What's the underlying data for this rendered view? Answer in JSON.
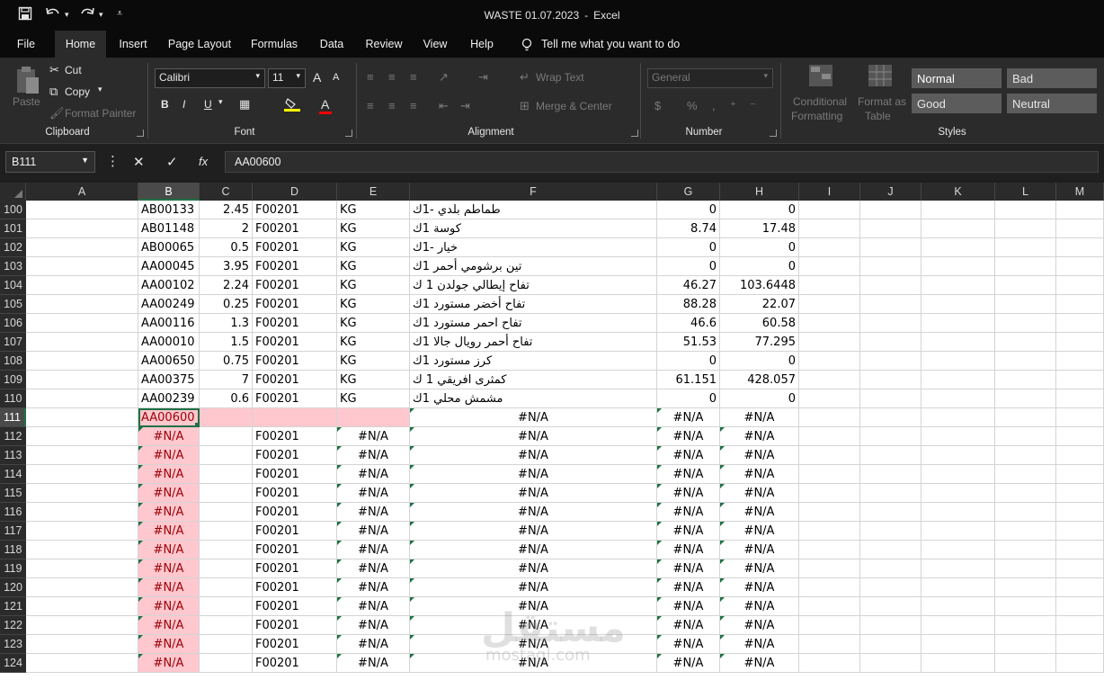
{
  "window": {
    "file_name": "WASTE 01.07.2023",
    "separator": "-",
    "app_name": "Excel"
  },
  "quick_access": {
    "save_icon": "save-icon",
    "undo_icon": "undo-icon",
    "redo_icon": "redo-icon",
    "customize_icon": "customize-icon"
  },
  "tabs": [
    "File",
    "Home",
    "Insert",
    "Page Layout",
    "Formulas",
    "Data",
    "Review",
    "View",
    "Help"
  ],
  "tell_me": "Tell me what you want to do",
  "ribbon": {
    "clipboard": {
      "paste": "Paste",
      "cut": "Cut",
      "copy": "Copy",
      "format_painter": "Format Painter",
      "label": "Clipboard"
    },
    "font": {
      "font_name": "Calibri",
      "font_size": "11",
      "bold": "B",
      "italic": "I",
      "underline": "U",
      "grow": "A",
      "shrink": "A",
      "font_color": "A",
      "label": "Font"
    },
    "alignment": {
      "wrap_text": "Wrap Text",
      "merge_center": "Merge & Center",
      "label": "Alignment"
    },
    "number": {
      "format": "General",
      "currency": "$",
      "percent": "%",
      "label": "Number"
    },
    "styles": {
      "conditional_formatting_1": "Conditional",
      "conditional_formatting_2": "Formatting",
      "format_as_table_1": "Format as",
      "format_as_table_2": "Table",
      "normal": "Normal",
      "bad": "Bad",
      "good": "Good",
      "neutral": "Neutral",
      "label": "Styles",
      "colors": {
        "normal_bg": "#5a5a5a",
        "bad_bg": "#5c5c5c",
        "good_bg": "#5c5c5c",
        "neutral_bg": "#5c5c5c"
      }
    }
  },
  "formula_bar": {
    "name_box": "B111",
    "cancel": "✕",
    "enter": "✓",
    "fx": "fx",
    "content": "AA00600"
  },
  "columns": [
    "A",
    "B",
    "C",
    "D",
    "E",
    "F",
    "G",
    "H",
    "I",
    "J",
    "K",
    "L",
    "M"
  ],
  "rows": [
    {
      "num": "100",
      "b": "AB00133",
      "c": "2.45",
      "d": "F00201",
      "e": "KG",
      "f": "طماطم بلدي -1ك",
      "g": "0",
      "h": "0"
    },
    {
      "num": "101",
      "b": "AB01148",
      "c": "2",
      "d": "F00201",
      "e": "KG",
      "f": "كوسة 1ك",
      "g": "8.74",
      "h": "17.48"
    },
    {
      "num": "102",
      "b": "AB00065",
      "c": "0.5",
      "d": "F00201",
      "e": "KG",
      "f": "خيار -1ك",
      "g": "0",
      "h": "0"
    },
    {
      "num": "103",
      "b": "AA00045",
      "c": "3.95",
      "d": "F00201",
      "e": "KG",
      "f": "تين برشومي أحمر 1ك",
      "g": "0",
      "h": "0"
    },
    {
      "num": "104",
      "b": "AA00102",
      "c": "2.24",
      "d": "F00201",
      "e": "KG",
      "f": "تفاح إيطالي جولدن 1 ك",
      "g": "46.27",
      "h": "103.6448"
    },
    {
      "num": "105",
      "b": "AA00249",
      "c": "0.25",
      "d": "F00201",
      "e": "KG",
      "f": "تفاح أخضر مستورد 1ك",
      "g": "88.28",
      "h": "22.07"
    },
    {
      "num": "106",
      "b": "AA00116",
      "c": "1.3",
      "d": "F00201",
      "e": "KG",
      "f": "تفاح احمر مستورد 1ك",
      "g": "46.6",
      "h": "60.58"
    },
    {
      "num": "107",
      "b": "AA00010",
      "c": "1.5",
      "d": "F00201",
      "e": "KG",
      "f": "تفاح أحمر رويال جالا 1ك",
      "g": "51.53",
      "h": "77.295"
    },
    {
      "num": "108",
      "b": "AA00650",
      "c": "0.75",
      "d": "F00201",
      "e": "KG",
      "f": "كرز مستورد 1ك",
      "g": "0",
      "h": "0"
    },
    {
      "num": "109",
      "b": "AA00375",
      "c": "7",
      "d": "F00201",
      "e": "KG",
      "f": "كمثرى افريقي 1 ك",
      "g": "61.151",
      "h": "428.057"
    },
    {
      "num": "110",
      "b": "AA00239",
      "c": "0.6",
      "d": "F00201",
      "e": "KG",
      "f": "مشمش محلي 1ك",
      "g": "0",
      "h": "0"
    }
  ],
  "active_row": {
    "num": "111",
    "b": "AA00600",
    "f": "#N/A",
    "g": "#N/A",
    "h": "#N/A"
  },
  "error_rows": {
    "nums": [
      "112",
      "113",
      "114",
      "115",
      "116",
      "117",
      "118",
      "119",
      "120",
      "121",
      "122",
      "123",
      "124"
    ],
    "b": "#N/A",
    "d": "F00201",
    "e": "#N/A",
    "f": "#N/A",
    "g": "#N/A",
    "h": "#N/A"
  },
  "watermark": {
    "arabic": "مستقل",
    "latin": "mostaql.com"
  }
}
